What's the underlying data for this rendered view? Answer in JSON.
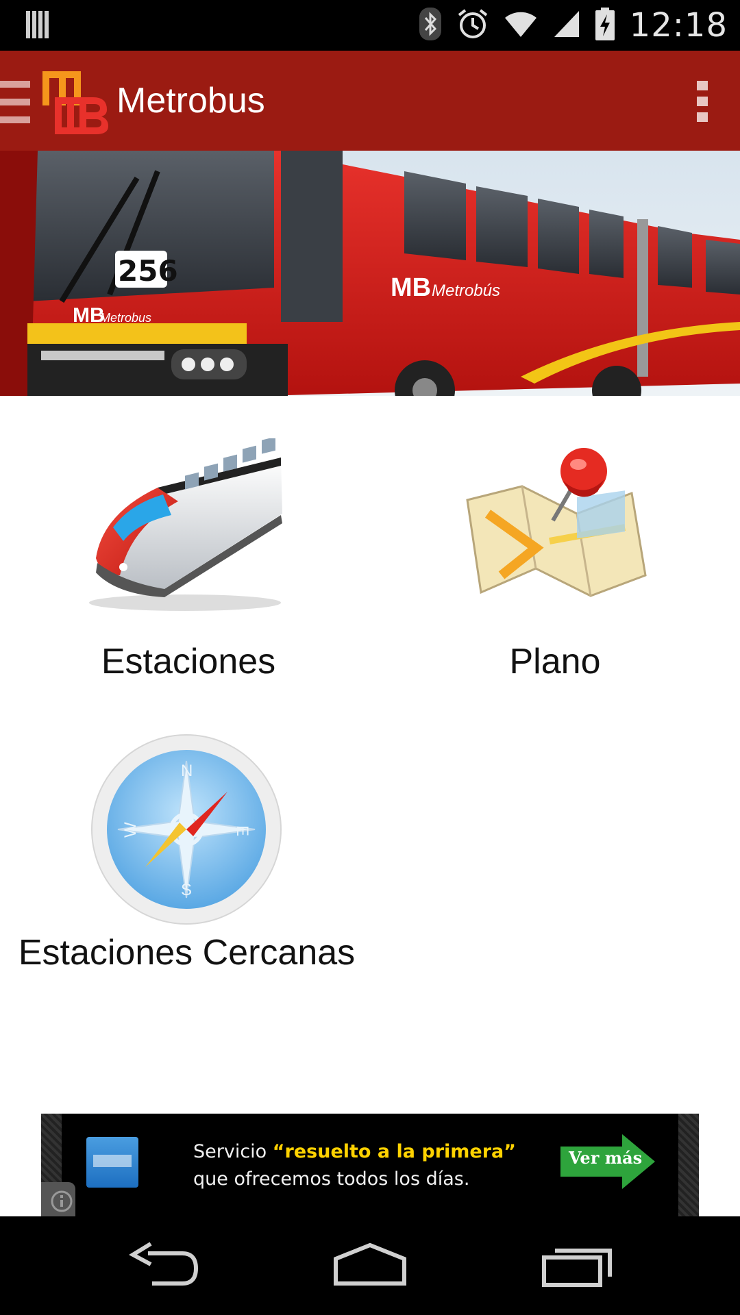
{
  "status_bar": {
    "time": "12:18",
    "icons": [
      "notification-icon",
      "bluetooth-icon",
      "alarm-icon",
      "wifi-icon",
      "signal-icon",
      "battery-charging-icon"
    ]
  },
  "action_bar": {
    "title": "Metrobus",
    "logo": "metrobus-logo",
    "drawer_icon": "drawer-menu-icon",
    "overflow_icon": "overflow-menu-icon",
    "color": "#9b1b12"
  },
  "banner": {
    "image": "metrobus-bus-photo",
    "bus_number": "256",
    "brand_text": "Metrobús"
  },
  "menu": {
    "items": [
      {
        "label": "Estaciones",
        "icon": "train-icon"
      },
      {
        "label": "Plano",
        "icon": "map-pin-icon"
      },
      {
        "label": "Estaciones Cercanas",
        "icon": "compass-icon"
      }
    ],
    "compass_letters": {
      "n": "N",
      "e": "E",
      "s": "S",
      "w": "W"
    }
  },
  "ad": {
    "line1_prefix": "Servicio ",
    "line1_highlight": "“resuelto a la primera”",
    "line2": "que ofrecemos todos los días.",
    "cta_label": "Ver más",
    "info_icon": "info-icon"
  },
  "nav_bar": {
    "buttons": [
      "back-icon",
      "home-icon",
      "recent-apps-icon"
    ]
  }
}
